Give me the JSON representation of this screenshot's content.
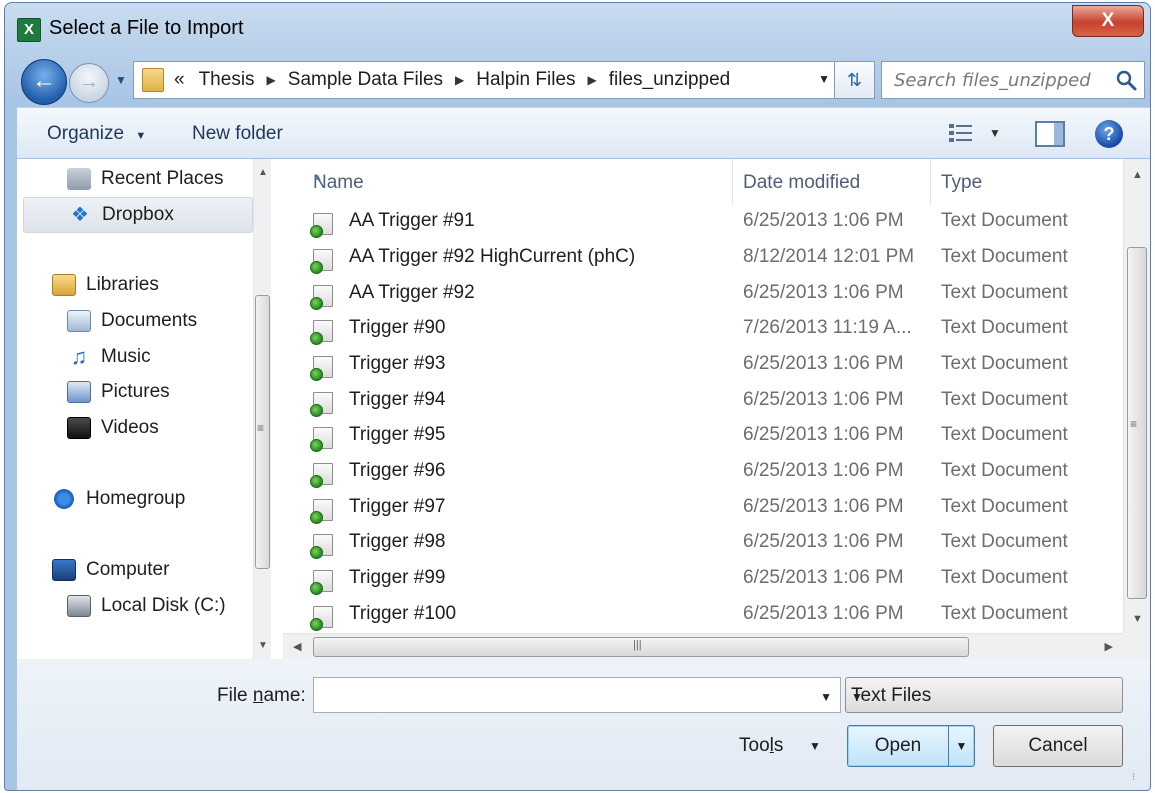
{
  "window": {
    "title": "Select a File to Import",
    "app_icon_letter": "X",
    "close_glyph": "X"
  },
  "address": {
    "overflow": "«",
    "crumbs": [
      "Thesis",
      "Sample Data Files",
      "Halpin Files",
      "files_unzipped"
    ],
    "search_placeholder": "Search files_unzipped"
  },
  "toolbar": {
    "organize_label": "Organize",
    "new_folder_label": "New folder",
    "help_glyph": "?"
  },
  "nav": {
    "items": [
      {
        "label": "Recent Places",
        "icon": "recent-places-icon"
      },
      {
        "label": "Dropbox",
        "icon": "dropbox-icon"
      },
      {
        "label": "Libraries",
        "icon": "libraries-icon"
      },
      {
        "label": "Documents",
        "icon": "documents-icon"
      },
      {
        "label": "Music",
        "icon": "music-icon"
      },
      {
        "label": "Pictures",
        "icon": "pictures-icon"
      },
      {
        "label": "Videos",
        "icon": "videos-icon"
      },
      {
        "label": "Homegroup",
        "icon": "homegroup-icon"
      },
      {
        "label": "Computer",
        "icon": "computer-icon"
      },
      {
        "label": "Local Disk (C:)",
        "icon": "local-disk-icon"
      }
    ],
    "selected": "Dropbox"
  },
  "files": {
    "columns": {
      "name": "Name",
      "date": "Date modified",
      "type": "Type"
    },
    "rows": [
      {
        "name": "AA Trigger #91",
        "date": "6/25/2013 1:06 PM",
        "type": "Text Document"
      },
      {
        "name": "AA Trigger #92 HighCurrent (phC)",
        "date": "8/12/2014 12:01 PM",
        "type": "Text Document"
      },
      {
        "name": "AA Trigger #92",
        "date": "6/25/2013 1:06 PM",
        "type": "Text Document"
      },
      {
        "name": "Trigger #90",
        "date": "7/26/2013 11:19 A...",
        "type": "Text Document"
      },
      {
        "name": "Trigger #93",
        "date": "6/25/2013 1:06 PM",
        "type": "Text Document"
      },
      {
        "name": "Trigger #94",
        "date": "6/25/2013 1:06 PM",
        "type": "Text Document"
      },
      {
        "name": "Trigger #95",
        "date": "6/25/2013 1:06 PM",
        "type": "Text Document"
      },
      {
        "name": "Trigger #96",
        "date": "6/25/2013 1:06 PM",
        "type": "Text Document"
      },
      {
        "name": "Trigger #97",
        "date": "6/25/2013 1:06 PM",
        "type": "Text Document"
      },
      {
        "name": "Trigger #98",
        "date": "6/25/2013 1:06 PM",
        "type": "Text Document"
      },
      {
        "name": "Trigger #99",
        "date": "6/25/2013 1:06 PM",
        "type": "Text Document"
      },
      {
        "name": "Trigger #100",
        "date": "6/25/2013 1:06 PM",
        "type": "Text Document"
      }
    ]
  },
  "bottom": {
    "file_name_label_pre": "File ",
    "file_name_label_accel": "n",
    "file_name_label_post": "ame:",
    "file_name_value": "",
    "filter_value": "Text Files",
    "tools_label_pre": "Too",
    "tools_label_accel": "l",
    "tools_label_post": "s",
    "open_label": "Open",
    "cancel_label": "Cancel"
  },
  "colors": {
    "accent": "#1f5ea8",
    "excel_green": "#1f7a3e",
    "close_red": "#c7422c"
  }
}
